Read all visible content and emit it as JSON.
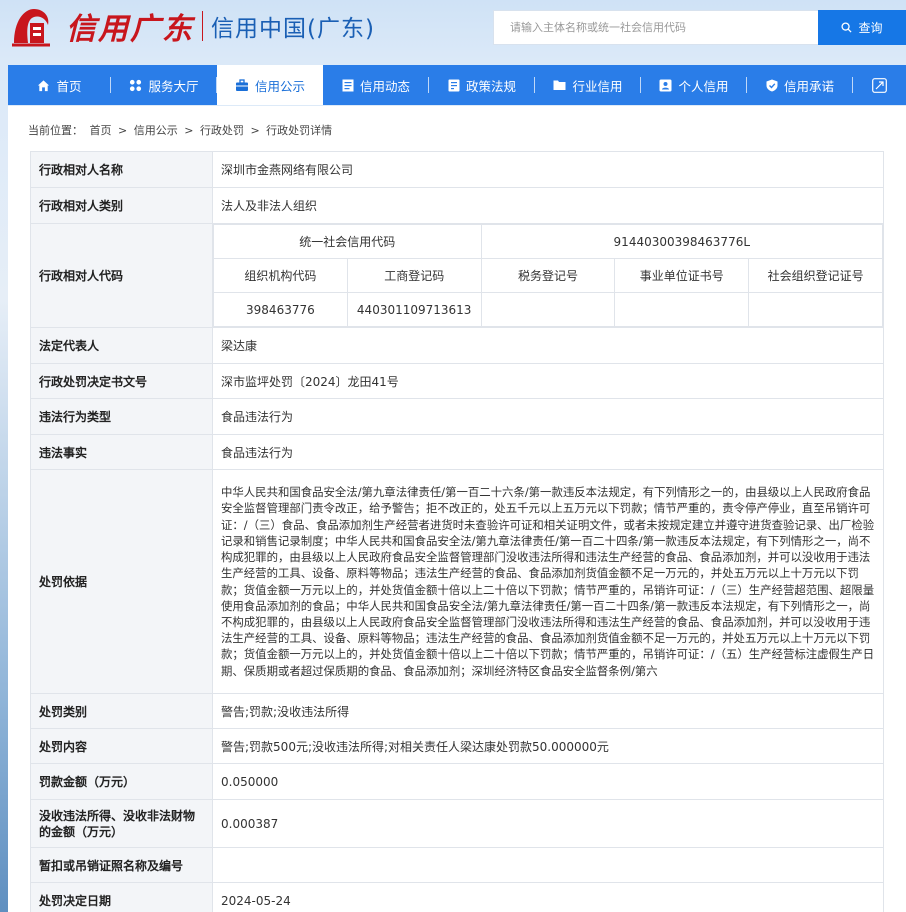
{
  "header": {
    "logo_text": "信用广东",
    "logo_subtext": "信用中国(广东)",
    "search_placeholder": "请输入主体名称或统一社会信用代码",
    "search_button": "查询"
  },
  "nav": [
    {
      "label": "首页",
      "icon": "home-icon"
    },
    {
      "label": "服务大厅",
      "icon": "grid-icon"
    },
    {
      "label": "信用公示",
      "icon": "briefcase-icon",
      "active": true
    },
    {
      "label": "信用动态",
      "icon": "news-icon"
    },
    {
      "label": "政策法规",
      "icon": "document-icon"
    },
    {
      "label": "行业信用",
      "icon": "folder-icon"
    },
    {
      "label": "个人信用",
      "icon": "id-card-icon"
    },
    {
      "label": "信用承诺",
      "icon": "shield-icon"
    }
  ],
  "breadcrumb": {
    "prefix": "当前位置：",
    "items": [
      "首页",
      "信用公示",
      "行政处罚",
      "行政处罚详情"
    ],
    "separator": ">"
  },
  "record": {
    "name_label": "行政相对人名称",
    "name_value": "深圳市金燕网络有限公司",
    "type_label": "行政相对人类别",
    "type_value": "法人及非法人组织",
    "code_label": "行政相对人代码",
    "codes": {
      "uscc_label": "统一社会信用代码",
      "uscc_value": "91440300398463776L",
      "headers": [
        "组织机构代码",
        "工商登记码",
        "税务登记号",
        "事业单位证书号",
        "社会组织登记证号"
      ],
      "values": [
        "398463776",
        "440301109713613",
        "",
        "",
        ""
      ]
    },
    "legal_rep_label": "法定代表人",
    "legal_rep_value": "梁达康",
    "doc_no_label": "行政处罚决定书文号",
    "doc_no_value": "深市监坪处罚〔2024〕龙田41号",
    "violation_type_label": "违法行为类型",
    "violation_type_value": "食品违法行为",
    "facts_label": "违法事实",
    "facts_value": "食品违法行为",
    "basis_label": "处罚依据",
    "basis_value": "中华人民共和国食品安全法/第九章法律责任/第一百二十六条/第一款违反本法规定，有下列情形之一的，由县级以上人民政府食品安全监督管理部门责令改正，给予警告；拒不改正的，处五千元以上五万元以下罚款；情节严重的，责令停产停业，直至吊销许可证：/（三）食品、食品添加剂生产经营者进货时未查验许可证和相关证明文件，或者未按规定建立并遵守进货查验记录、出厂检验记录和销售记录制度；中华人民共和国食品安全法/第九章法律责任/第一百二十四条/第一款违反本法规定，有下列情形之一，尚不构成犯罪的，由县级以上人民政府食品安全监督管理部门没收违法所得和违法生产经营的食品、食品添加剂，并可以没收用于违法生产经营的工具、设备、原料等物品；违法生产经营的食品、食品添加剂货值金额不足一万元的，并处五万元以上十万元以下罚款；货值金额一万元以上的，并处货值金额十倍以上二十倍以下罚款；情节严重的，吊销许可证：/（三）生产经营超范围、超限量使用食品添加剂的食品；中华人民共和国食品安全法/第九章法律责任/第一百二十四条/第一款违反本法规定，有下列情形之一，尚不构成犯罪的，由县级以上人民政府食品安全监督管理部门没收违法所得和违法生产经营的食品、食品添加剂，并可以没收用于违法生产经营的工具、设备、原料等物品；违法生产经营的食品、食品添加剂货值金额不足一万元的，并处五万元以上十万元以下罚款；货值金额一万元以上的，并处货值金额十倍以上二十倍以下罚款；情节严重的，吊销许可证：/（五）生产经营标注虚假生产日期、保质期或者超过保质期的食品、食品添加剂；深圳经济特区食品安全监督条例/第六",
    "category_label": "处罚类别",
    "category_value": "警告;罚款;没收违法所得",
    "content_label": "处罚内容",
    "content_value": "警告;罚款500元;没收违法所得;对相关责任人梁达康处罚款50.000000元",
    "fine_label": "罚款金额（万元）",
    "fine_value": "0.050000",
    "confiscation_label": "没收违法所得、没收非法财物的金额（万元）",
    "confiscation_value": "0.000387",
    "suspension_label": "暂扣或吊销证照名称及编号",
    "suspension_value": "",
    "date_label": "处罚决定日期",
    "date_value": "2024-05-24"
  }
}
